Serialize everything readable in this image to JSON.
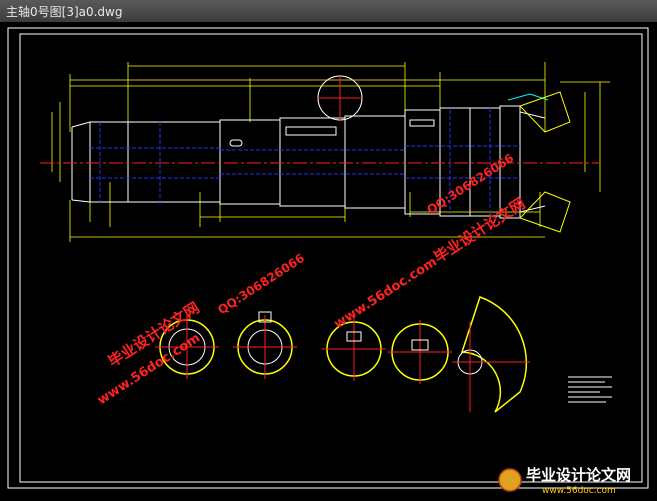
{
  "window": {
    "title": "主轴0号图[3]a0.dwg"
  },
  "watermarks": {
    "site": "www.56doc.com",
    "brand": "毕业设计论文网",
    "qq": "QQ:306826066"
  },
  "footer": {
    "brand": "毕业设计论文网",
    "site": "www.56doc.com"
  },
  "colors": {
    "background": "#000000",
    "frame": "#ffffff",
    "dimension": "#ffff00",
    "geometry": "#ffffff",
    "centerline": "#ff0000",
    "hidden": "#0000ff",
    "highlight": "#00ffff",
    "watermark": "#ff2222"
  }
}
